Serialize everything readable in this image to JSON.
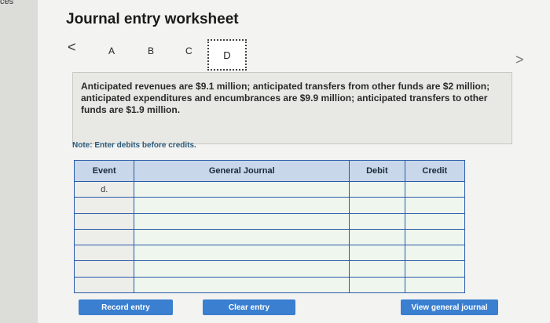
{
  "corner_text": "ces",
  "title": "Journal entry worksheet",
  "nav": {
    "prev": "<",
    "next": ">"
  },
  "tabs": [
    {
      "label": "A"
    },
    {
      "label": "B"
    },
    {
      "label": "C"
    },
    {
      "label": "D",
      "active": true
    }
  ],
  "description": "Anticipated revenues are $9.1 million; anticipated transfers from other funds are $2 million; anticipated expenditures and encumbrances are $9.9 million; anticipated transfers to other funds are $1.9 million.",
  "note": "Note: Enter debits before credits.",
  "table": {
    "headers": {
      "event": "Event",
      "general_journal": "General Journal",
      "debit": "Debit",
      "credit": "Credit"
    },
    "event_label": "d."
  },
  "buttons": {
    "record": "Record entry",
    "clear": "Clear entry",
    "view": "View general journal"
  }
}
